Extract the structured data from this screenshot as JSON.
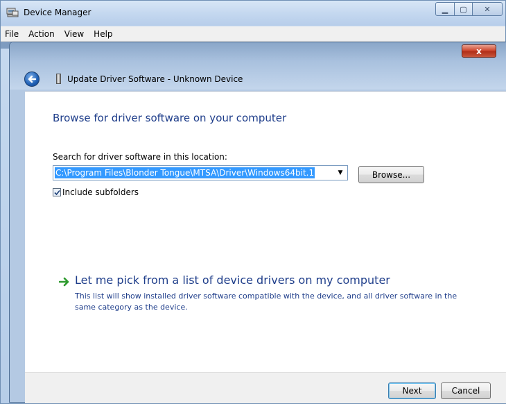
{
  "window": {
    "title": "Device Manager",
    "min_glyph": "▁",
    "max_glyph": "▢",
    "close_glyph": "✕"
  },
  "menu": {
    "items": [
      "File",
      "Action",
      "View",
      "Help"
    ]
  },
  "dialog": {
    "title": "Update Driver Software - Unknown Device",
    "close_glyph": "x",
    "heading": "Browse for driver software on your computer",
    "search_label": "Search for driver software in this location:",
    "path_value": "C:\\Program Files\\Blonder Tongue\\MTSA\\Driver\\Windows64bit.1",
    "browse_label": "Browse...",
    "include_subfolders": {
      "label": "Include subfolders",
      "checked": true,
      "check_glyph": "✓"
    },
    "pick": {
      "title": "Let me pick from a list of device drivers on my computer",
      "description": "This list will show installed driver software compatible with the device, and all driver software in the same category as the device."
    },
    "buttons": {
      "next": "Next",
      "cancel": "Cancel"
    }
  },
  "colors": {
    "heading": "#1e3d8a",
    "selection": "#3399ff",
    "arrow_green": "#2e9a2e"
  },
  "icons": {
    "app": "device-manager-icon",
    "back": "back-arrow-icon",
    "wizard": "device-icon",
    "link": "green-arrow-icon",
    "dropdown": "chevron-down-icon"
  }
}
